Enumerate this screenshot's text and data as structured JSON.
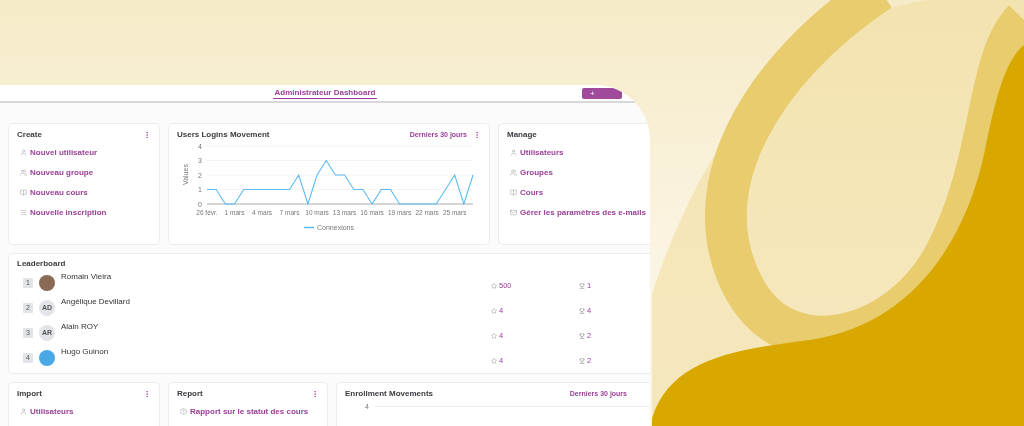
{
  "top_bar": {
    "tabs": [
      {
        "label": "Administrateur Dashboard",
        "selected": true
      }
    ],
    "add_button": "+"
  },
  "create": {
    "title": "Create",
    "links": [
      {
        "kind": "user",
        "label": "Nouvel utilisateur"
      },
      {
        "kind": "group",
        "label": "Nouveau groupe"
      },
      {
        "kind": "course",
        "label": "Nouveau cours"
      },
      {
        "kind": "enrollment",
        "label": "Nouvelle inscription"
      }
    ]
  },
  "logins_chart": {
    "title": "Users Logins Movement",
    "period": "Derniers 30 jours",
    "chart_data": {
      "type": "line",
      "ylabel": "Values",
      "categories": [
        "26 févr.",
        null,
        null,
        "1 mars",
        null,
        null,
        "4 mars",
        null,
        null,
        "7 mars",
        null,
        null,
        "10 mars",
        null,
        null,
        "13 mars",
        null,
        null,
        "16 mars",
        null,
        null,
        "19 mars",
        null,
        null,
        "22 mars",
        null,
        null,
        "25 mars",
        null,
        null
      ],
      "series": [
        {
          "name": "Connexions",
          "color": "#5bbcf5",
          "values": [
            1,
            1,
            0,
            0,
            1,
            1,
            1,
            1,
            1,
            1,
            2,
            0,
            2,
            3,
            2,
            2,
            1,
            1,
            0,
            1,
            1,
            0,
            0,
            0,
            0,
            0,
            1,
            2,
            0,
            2
          ]
        }
      ],
      "ylim": [
        0,
        4
      ],
      "yticks": [
        0,
        1,
        2,
        3,
        4
      ],
      "grid": true
    }
  },
  "manage": {
    "title": "Manage",
    "links": [
      {
        "kind": "user",
        "label": "Utilisateurs"
      },
      {
        "kind": "group",
        "label": "Groupes"
      },
      {
        "kind": "course",
        "label": "Cours"
      },
      {
        "kind": "email",
        "label": "Gérer les paramètres des e-mails"
      }
    ]
  },
  "leaderboard": {
    "title": "Leaderboard",
    "rows": [
      {
        "rank": "1",
        "kind": "photo",
        "name": "Romain Vieira",
        "points": "500",
        "trophies": "1"
      },
      {
        "rank": "2",
        "kind": "initials",
        "initials": "AD",
        "name": "Angélique Devillard",
        "points": "4",
        "trophies": "4"
      },
      {
        "rank": "3",
        "kind": "initials",
        "initials": "AR",
        "name": "Alain ROY",
        "points": "4",
        "trophies": "2"
      },
      {
        "rank": "4",
        "kind": "logo",
        "name": "Hugo Guinon",
        "points": "4",
        "trophies": "2"
      }
    ]
  },
  "import": {
    "title": "Import",
    "links": [
      {
        "kind": "user",
        "label": "Utilisateurs"
      }
    ]
  },
  "report": {
    "title": "Report",
    "links": [
      {
        "kind": "report",
        "label": "Rapport sur le statut des cours"
      }
    ]
  },
  "enrollment_chart": {
    "title": "Enrollment Movements",
    "period": "Derniers 30 jours",
    "axis_tick": "4"
  }
}
